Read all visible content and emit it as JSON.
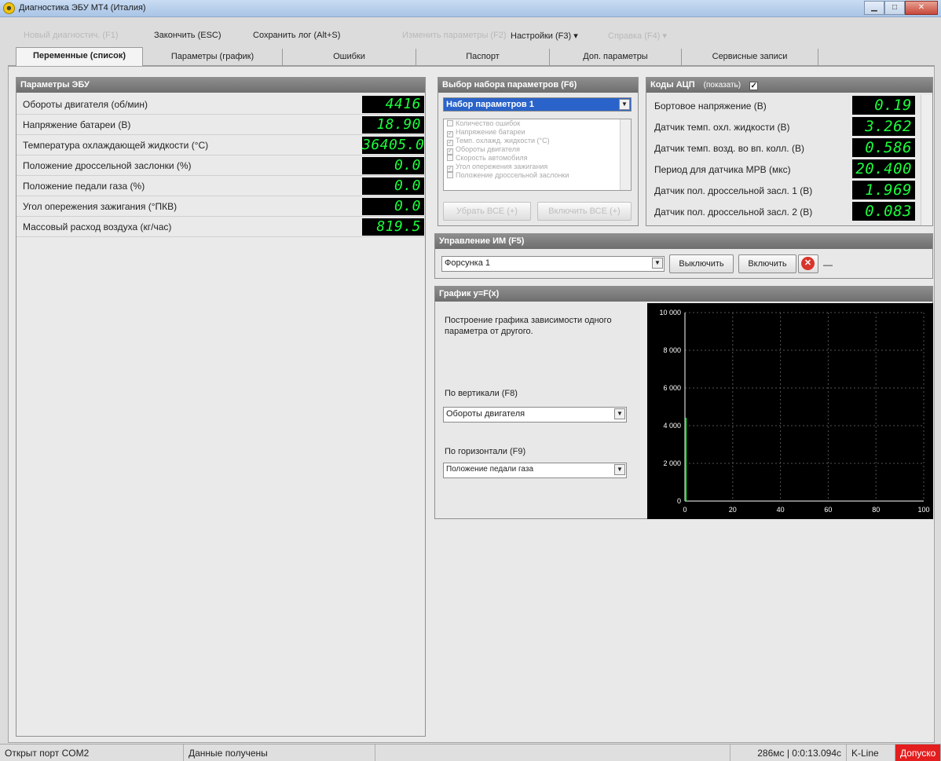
{
  "window": {
    "title": "Диагностика ЭБУ МТ4 (Италия)"
  },
  "menu": {
    "item1": "Новый диагностич. (F1)",
    "finish": "Закончить (ESC)",
    "save_log": "Сохранить лог (Alt+S)",
    "item4": "Изменить параметры (F2)",
    "settings": "Настройки (F3) ▾",
    "item6": "Справка (F4) ▾"
  },
  "tabs": [
    "Переменные (список)",
    "Параметры (график)",
    "Ошибки",
    "Паспорт",
    "Доп. параметры",
    "Сервисные записи"
  ],
  "ecu_panel": {
    "title": "Параметры ЭБУ",
    "rows": [
      {
        "label": "Обороты двигателя (об/мин)",
        "value": "4416"
      },
      {
        "label": "Напряжение батареи (В)",
        "value": "18.90"
      },
      {
        "label": "Температура охлаждающей жидкости (°C)",
        "value": "36405.0"
      },
      {
        "label": "Положение дроссельной заслонки (%)",
        "value": "0.0"
      },
      {
        "label": "Положение педали газа (%)",
        "value": "0.0"
      },
      {
        "label": "Угол опережения зажигания (°ПКВ)",
        "value": "0.0"
      },
      {
        "label": "Массовый расход воздуха (кг/час)",
        "value": "819.5"
      }
    ]
  },
  "param_set": {
    "title": "Выбор набора параметров (F6)",
    "selected": "Набор параметров 1",
    "items": [
      {
        "label": "Количество ошибок",
        "checked": false
      },
      {
        "label": "Напряжение батареи",
        "checked": true
      },
      {
        "label": "Темп. охлажд. жидкости (°C)",
        "checked": true
      },
      {
        "label": "Обороты двигателя",
        "checked": true
      },
      {
        "label": "Скорость автомобиля",
        "checked": false
      },
      {
        "label": "Угол опережения зажигания",
        "checked": true
      },
      {
        "label": "Положение дроссельной заслонки",
        "checked": false
      }
    ],
    "remove_all": "Убрать ВСЕ (+)",
    "enable_all": "Включить ВСЕ (+)"
  },
  "adc": {
    "title": "Коды АЦП",
    "show": "(показать)",
    "rows": [
      {
        "label": "Бортовое напряжение (В)",
        "value": "0.19"
      },
      {
        "label": "Датчик темп. охл. жидкости (В)",
        "value": "3.262"
      },
      {
        "label": "Датчик темп. возд. во вп. колл. (В)",
        "value": "0.586"
      },
      {
        "label": "Период для датчика МРВ (мкс)",
        "value": "20.400"
      },
      {
        "label": "Датчик пол. дроссельной засл. 1 (В)",
        "value": "1.969"
      },
      {
        "label": "Датчик пол. дроссельной засл. 2 (В)",
        "value": "0.083"
      }
    ]
  },
  "control": {
    "title": "Управление ИМ (F5)",
    "selected": "Форсунка 1",
    "off_label": "Выключить",
    "on_label": "Включить",
    "dash": "—"
  },
  "graph": {
    "title": "График y=F(x)",
    "desc": "Построение графика зависимости одного параметра от другого.",
    "vertical_label": "По вертикали (F8)",
    "vertical_value": "Обороты двигателя",
    "horizontal_label": "По горизонтали (F9)",
    "horizontal_value": "Положение педали газа"
  },
  "chart_data": {
    "type": "scatter",
    "x": [
      0
    ],
    "y": [
      4416
    ],
    "xlim": [
      0,
      100
    ],
    "ylim": [
      0,
      10000
    ],
    "x_ticks": [
      "0",
      "20",
      "40",
      "60",
      "80",
      "100"
    ],
    "y_ticks": [
      "0",
      "2 000",
      "4 000",
      "6 000",
      "8 000",
      "10 000"
    ],
    "grid": true,
    "colors": {
      "background": "#000000",
      "grid": "#555555",
      "series": "#1bff3c",
      "axis": "#ffffff"
    }
  },
  "status": {
    "port": "Открыт порт COM2",
    "data": "Данные получены",
    "timing": "286мс | 0:0:13.094с",
    "protocol": "K-Line",
    "alert": "Допуско"
  },
  "colors": {
    "lcd_text": "#1bff3c",
    "lcd_bg": "#000000",
    "panel_header": "#7a7a7a",
    "selection": "#2a63c9",
    "alert": "#e41e1e"
  }
}
